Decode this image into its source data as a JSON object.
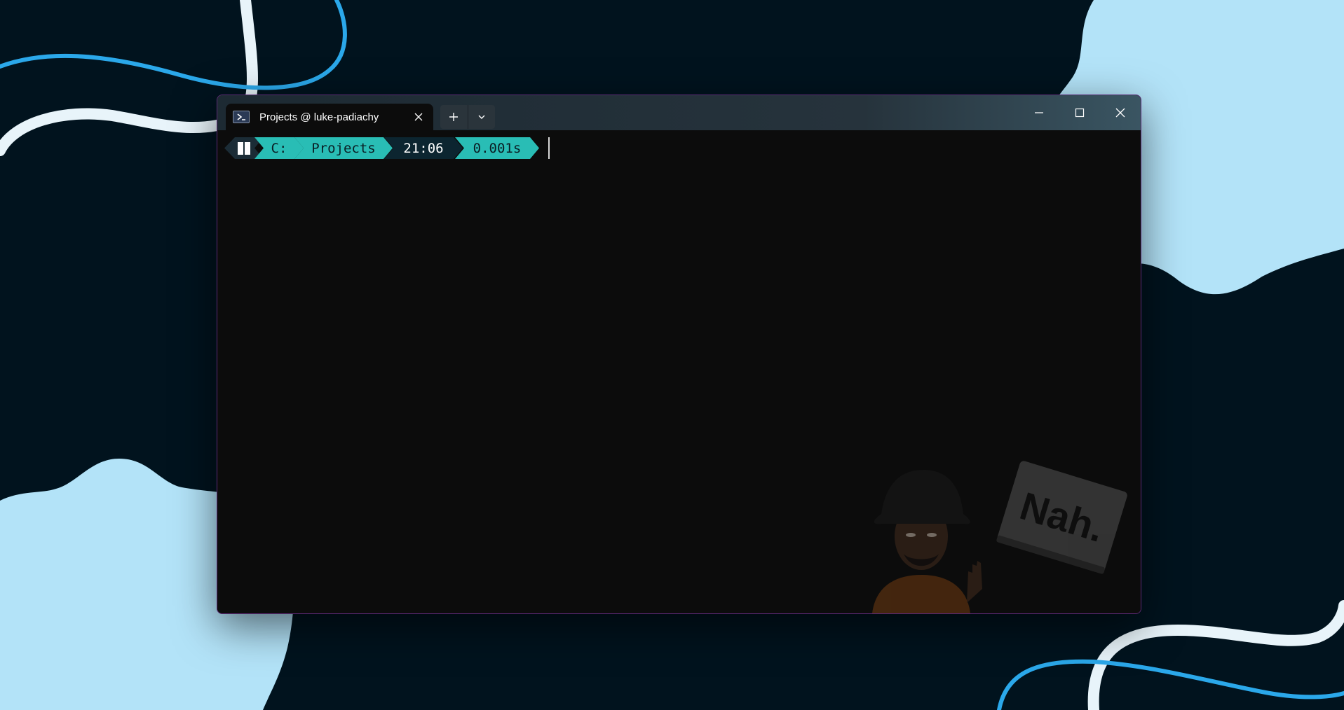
{
  "theme": {
    "desktop_bg": "#01131e",
    "blob_color": "#b3e3f8",
    "ribbon_blue": "#2ba8ea",
    "ribbon_white": "#e8f4fa",
    "accent_teal": "#29bdb5",
    "window_border": "#5c2a76"
  },
  "window": {
    "tab": {
      "icon": "powershell-icon",
      "title": "Projects @ luke-padiachy",
      "close_icon": "close-icon"
    },
    "new_tab_icon": "plus-icon",
    "dropdown_icon": "chevron-down-icon",
    "controls": [
      "minimize-icon",
      "maximize-icon",
      "close-icon"
    ]
  },
  "prompt": {
    "os_icon": "windows-icon",
    "drive": "C:",
    "path": "Projects",
    "time": "21:06",
    "duration": "0.001s"
  },
  "background_image": {
    "sign_text": "Nah."
  }
}
